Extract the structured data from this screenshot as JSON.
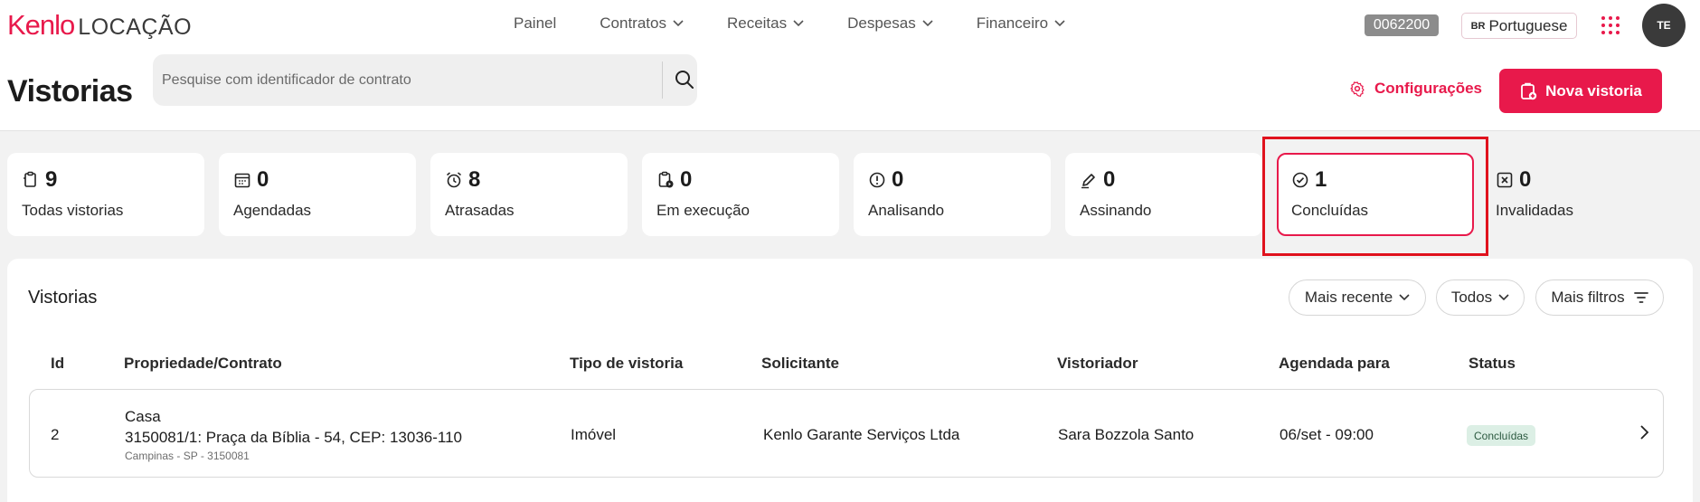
{
  "brand": {
    "name": "Kenlo",
    "product": "LOCAÇÃO",
    "color": "#e8194b"
  },
  "nav": [
    {
      "label": "Painel",
      "dropdown": false
    },
    {
      "label": "Contratos",
      "dropdown": true
    },
    {
      "label": "Receitas",
      "dropdown": true
    },
    {
      "label": "Despesas",
      "dropdown": true
    },
    {
      "label": "Financeiro",
      "dropdown": true
    }
  ],
  "header": {
    "code": "0062200",
    "language_flag": "BR",
    "language": "Portuguese",
    "apps_icon": "apps-grid-icon",
    "avatar_initials": "TE"
  },
  "page": {
    "title": "Vistorias"
  },
  "search": {
    "placeholder": "Pesquise com identificador de contrato",
    "value": ""
  },
  "actions": {
    "config_label": "Configurações",
    "new_label": "Nova vistoria"
  },
  "status_cards": [
    {
      "key": "todas",
      "count": "9",
      "label": "Todas vistorias",
      "icon": "clipboard-icon"
    },
    {
      "key": "agendadas",
      "count": "0",
      "label": "Agendadas",
      "icon": "calendar-icon"
    },
    {
      "key": "atrasadas",
      "count": "8",
      "label": "Atrasadas",
      "icon": "alarm-clock-icon"
    },
    {
      "key": "execucao",
      "count": "0",
      "label": "Em execução",
      "icon": "clipboard-play-icon"
    },
    {
      "key": "analisando",
      "count": "0",
      "label": "Analisando",
      "icon": "alert-circle-icon"
    },
    {
      "key": "assinando",
      "count": "0",
      "label": "Assinando",
      "icon": "pen-icon"
    },
    {
      "key": "concluidas",
      "count": "1",
      "label": "Concluídas",
      "icon": "check-circle-icon",
      "selected": true
    },
    {
      "key": "invalidadas",
      "count": "0",
      "label": "Invalidadas",
      "icon": "x-square-icon"
    }
  ],
  "list": {
    "title": "Vistorias",
    "sort_label": "Mais recente",
    "scope_label": "Todos",
    "filters_label": "Mais filtros",
    "columns": [
      "Id",
      "Propriedade/Contrato",
      "Tipo de vistoria",
      "Solicitante",
      "Vistoriador",
      "Agendada para",
      "Status"
    ],
    "rows": [
      {
        "id": "2",
        "property_type": "Casa",
        "contract_address": "3150081/1: Praça da Bíblia - 54, CEP: 13036-110",
        "location": "Campinas - SP - 3150081",
        "inspection_type": "Imóvel",
        "requester": "Kenlo Garante Serviços Ltda",
        "inspector": "Sara Bozzola Santo",
        "scheduled_for": "06/set - 09:00",
        "status": "Concluídas"
      }
    ]
  },
  "colors": {
    "accent": "#e8194b",
    "highlight_border": "#e0121d",
    "status_concluida_bg": "#dcefe5"
  }
}
